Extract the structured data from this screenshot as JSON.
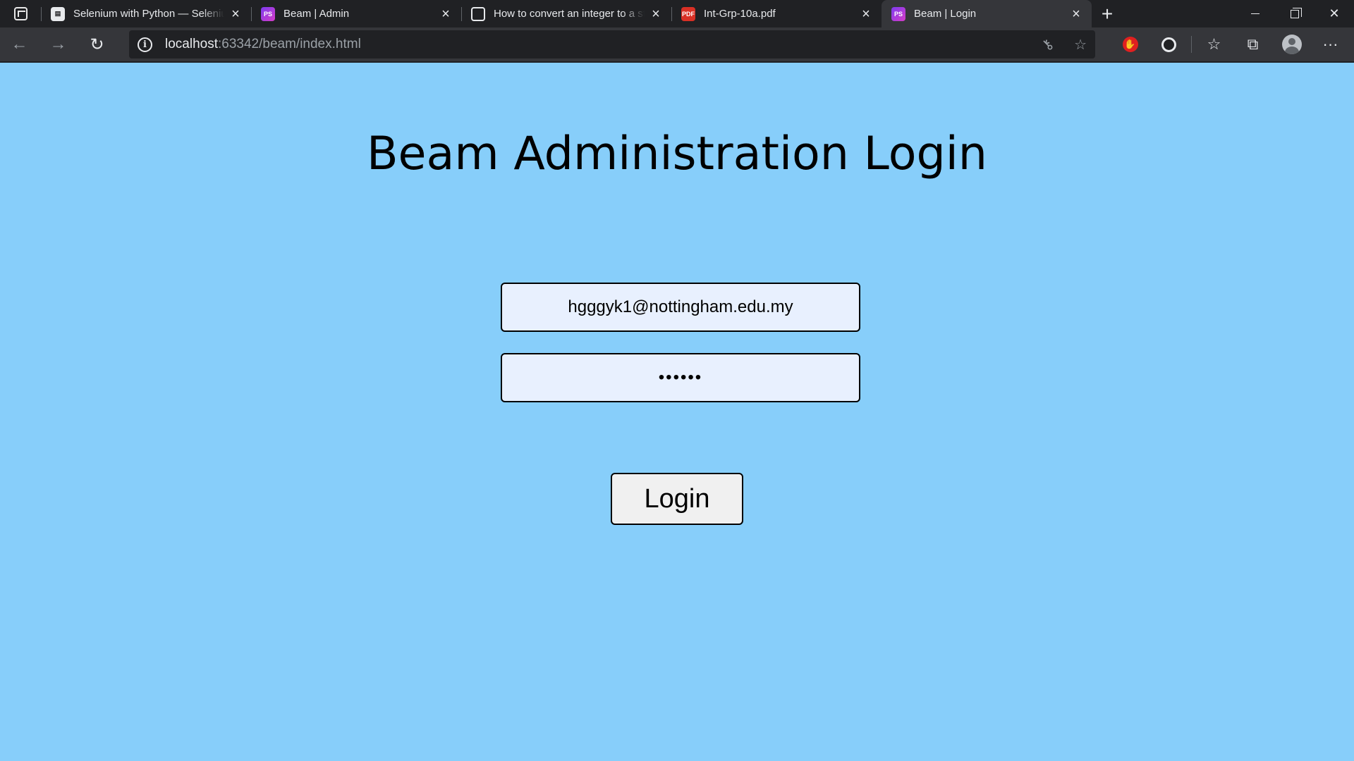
{
  "browser": {
    "tabs": [
      {
        "title": "Selenium with Python — Seleniu",
        "icon": "document-icon",
        "active": false
      },
      {
        "title": "Beam | Admin",
        "icon": "phpstorm-icon",
        "active": false
      },
      {
        "title": "How to convert an integer to a st",
        "icon": "terminal-icon",
        "active": false
      },
      {
        "title": "Int-Grp-10a.pdf",
        "icon": "pdf-icon",
        "active": false
      },
      {
        "title": "Beam | Login",
        "icon": "phpstorm-icon",
        "active": true
      }
    ],
    "fav_labels": {
      "ps": "PS",
      "pdf": "PDF"
    },
    "address": {
      "host": "localhost",
      "rest": ":63342/beam/index.html"
    }
  },
  "page": {
    "title": "Beam Administration Login",
    "email_value": "hgggyk1@nottingham.edu.my",
    "password_value": "••••••",
    "login_label": "Login",
    "background_color": "#87cefa"
  }
}
